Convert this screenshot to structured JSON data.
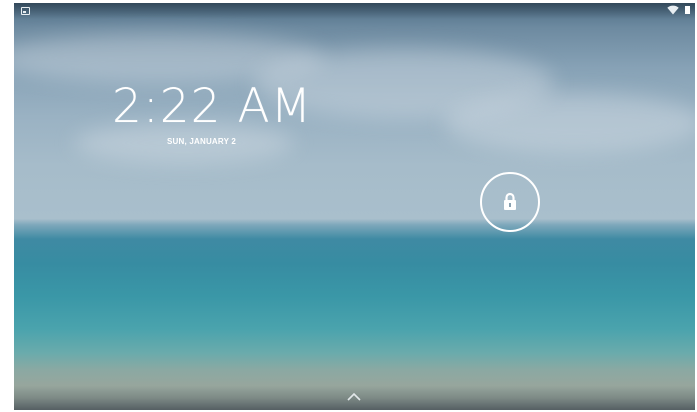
{
  "status_bar": {
    "left_icon": "image-notification-icon",
    "right_icons": [
      "wifi-icon",
      "battery-icon"
    ]
  },
  "lockscreen": {
    "time": "2:22 AM",
    "date": "SUN, JANUARY 2",
    "unlock_icon": "lock-icon",
    "swipe_hint_icon": "chevron-up-icon"
  },
  "colors": {
    "text": "#ffffff",
    "sky": "#9ab2c3",
    "sea": "#378ca2"
  }
}
